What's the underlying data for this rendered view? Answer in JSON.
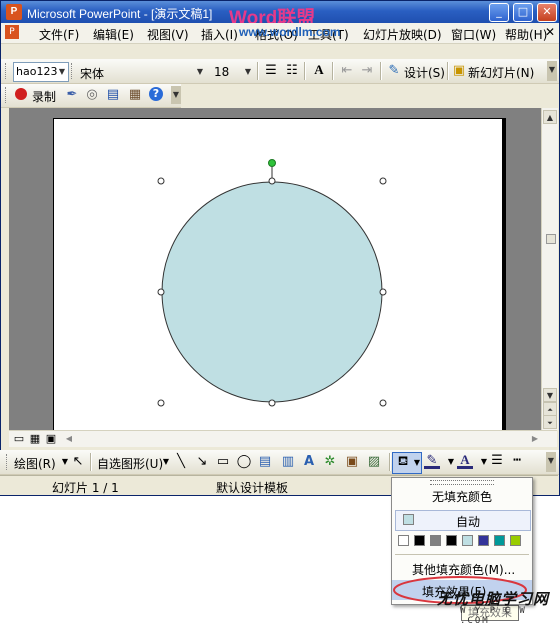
{
  "window": {
    "title": "Microsoft PowerPoint - [演示文稿1]",
    "app_icon_letter": "P",
    "caption_buttons": {
      "minimize": "_",
      "restore": "□",
      "close": "✕"
    }
  },
  "watermark": {
    "brand": "Word联盟",
    "url": "www.wordlm.com"
  },
  "menubar": {
    "items": [
      "文件(F)",
      "编辑(E)",
      "视图(V)",
      "插入(I)",
      "格式(O)",
      "工具(T)",
      "幻灯片放映(D)",
      "窗口(W)",
      "帮助(H)"
    ],
    "close_glyph": "✕"
  },
  "toolbar1": {
    "name_combo": "hao123",
    "font_combo": "宋体",
    "size_combo": "18",
    "design_label": "设计(S)",
    "new_slide_label": "新幻灯片(N)"
  },
  "toolbar2": {
    "record_label": "录制"
  },
  "drawing_toolbar": {
    "draw_label": "绘图(R)",
    "autoshape_label": "自选图形(U)"
  },
  "statusbar": {
    "slide_info": "幻灯片 1 / 1",
    "template": "默认设计模板"
  },
  "fill_menu": {
    "no_fill": "无填充颜色",
    "automatic": "自动",
    "more_colors": "其他填充颜色(M)...",
    "fill_effects": "填充效果(F)...",
    "tooltip": "填充效果"
  },
  "colors": {
    "shape_fill": "#bfdfe3",
    "palette": [
      "#ffffff",
      "#000000",
      "#808080",
      "#000000",
      "#bfdfe3",
      "#333399",
      "#009999",
      "#99cc00"
    ],
    "highlight_oval": "#d9363e"
  },
  "site_brand": {
    "text": "无忧电脑学习网",
    "url": "W Y P C W .COM"
  }
}
